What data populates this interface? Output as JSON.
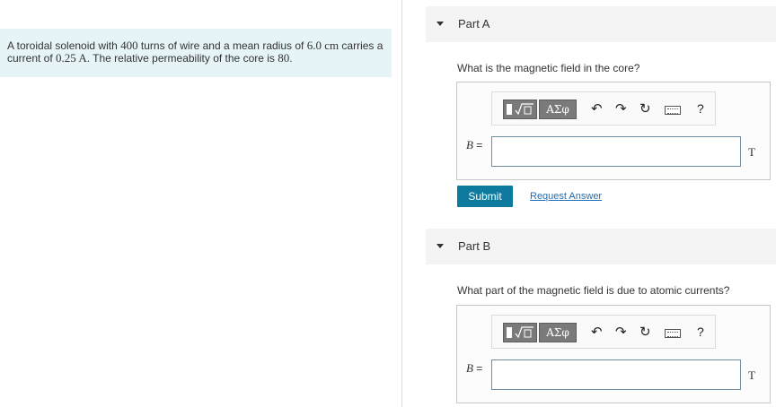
{
  "problem": {
    "text_1": "A toroidal solenoid with ",
    "turns": "400",
    "text_2": " turns of wire and a mean radius of ",
    "radius": "6.0 cm",
    "text_3": " carries a current of ",
    "current": "0.25 A",
    "text_4": ". The relative permeability of the core is ",
    "permeability": "80",
    "text_5": "."
  },
  "toolbar": {
    "greek_label": "ΑΣφ",
    "help_label": "?"
  },
  "parts": [
    {
      "title": "Part A",
      "question": "What is the magnetic field in the core?",
      "variable": "B",
      "equals": "=",
      "unit": "T",
      "submit_label": "Submit",
      "request_label": "Request Answer"
    },
    {
      "title": "Part B",
      "question": "What part of the magnetic field is due to atomic currents?",
      "variable": "B",
      "equals": "=",
      "unit": "T"
    }
  ]
}
